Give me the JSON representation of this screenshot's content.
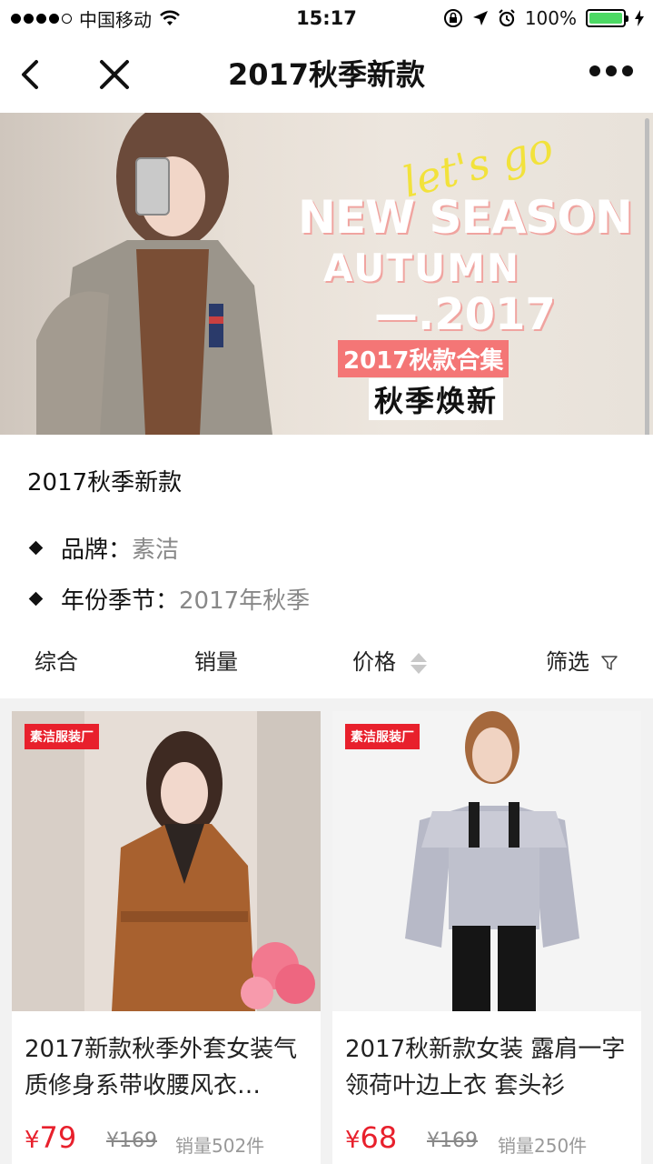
{
  "status_bar": {
    "carrier": "中国移动",
    "time": "15:17",
    "battery": "100%",
    "battery_color": "#4cd964"
  },
  "nav": {
    "title": "2017秋季新款",
    "back_icon": "back-chevron-icon",
    "close_icon": "close-icon",
    "more_icon": "more-dots-icon"
  },
  "banner": {
    "script_text": "let's go",
    "line1": "NEW SEASON",
    "line2": "AUTUMN",
    "line3": "—.2017",
    "tag": "2017秋款合集",
    "subtitle": "秋季焕新"
  },
  "info": {
    "name": "2017秋季新款",
    "attributes": [
      {
        "label": "品牌：",
        "value": "素洁"
      },
      {
        "label": "年份季节：",
        "value": "2017年秋季"
      }
    ]
  },
  "sort_bar": {
    "comprehensive": "综合",
    "sales": "销量",
    "price": "价格",
    "filter": "筛选"
  },
  "products": [
    {
      "badge": "素洁服装厂",
      "title": "2017新款秋季外套女装气质修身系带收腰风衣…",
      "currency": "¥",
      "price": "79",
      "old_price": "¥169",
      "sales": "销量502件"
    },
    {
      "badge": "素洁服装厂",
      "title": "2017秋新款女装 露肩一字领荷叶边上衣 套头衫",
      "currency": "¥",
      "price": "68",
      "old_price": "¥169",
      "sales": "销量250件"
    }
  ],
  "colors": {
    "accent_red": "#e8202c",
    "banner_tag": "#f47676",
    "banner_script": "#f2e23b"
  }
}
